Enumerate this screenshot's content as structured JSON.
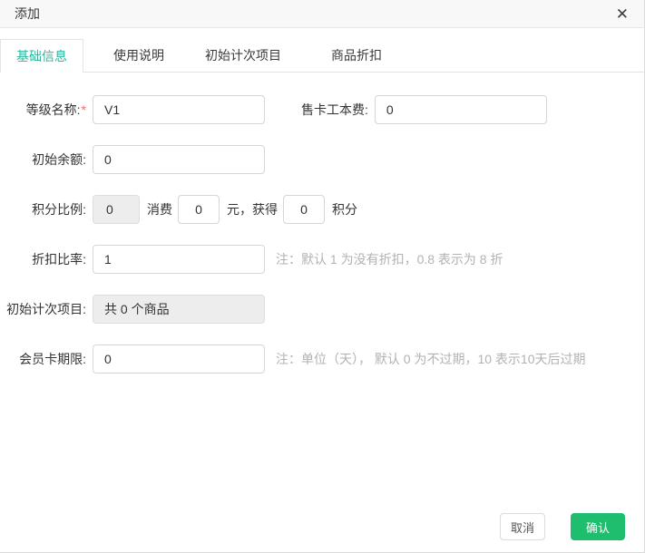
{
  "dialog": {
    "title": "添加",
    "close_icon": "✕"
  },
  "tabs": [
    {
      "label": "基础信息",
      "active": true
    },
    {
      "label": "使用说明",
      "active": false
    },
    {
      "label": "初始计次项目",
      "active": false
    },
    {
      "label": "商品折扣",
      "active": false
    }
  ],
  "form": {
    "level_name": {
      "label": "等级名称:",
      "required_mark": "*",
      "value": "V1"
    },
    "card_fee": {
      "label": "售卡工本费:",
      "value": "0"
    },
    "initial_balance": {
      "label": "初始余额:",
      "value": "0"
    },
    "points_ratio": {
      "label": "积分比例:",
      "base_value": "0",
      "consume_label": "消费",
      "consume_value": "0",
      "mid_label": "元，获得",
      "gain_value": "0",
      "end_label": "积分"
    },
    "discount_ratio": {
      "label": "折扣比率:",
      "value": "1",
      "note": "注：默认 1 为没有折扣，0.8 表示为 8 折"
    },
    "initial_count_items": {
      "label": "初始计次项目:",
      "value": "共 0 个商品"
    },
    "card_duration": {
      "label": "会员卡期限:",
      "value": "0",
      "note": "注：单位（天）， 默认 0 为不过期，10 表示10天后过期"
    }
  },
  "footer": {
    "cancel_label": "取消",
    "confirm_label": "确认"
  },
  "colors": {
    "tab_active": "#2db79a",
    "confirm_green": "#1fbe6e",
    "required_red": "#f56c6c",
    "note_gray": "#b2b2b2"
  }
}
